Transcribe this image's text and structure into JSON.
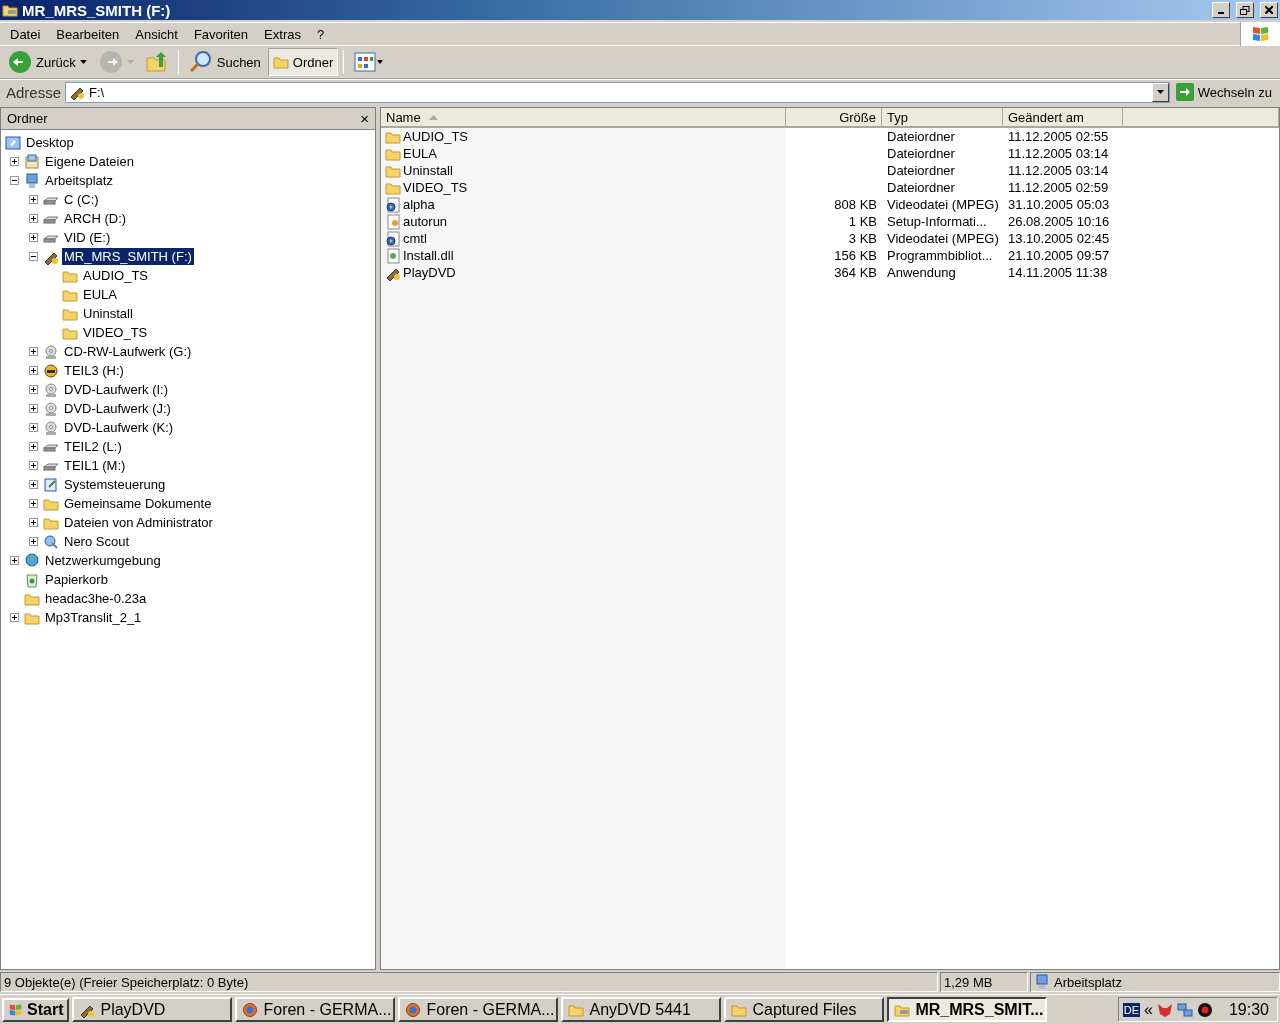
{
  "window": {
    "title": "MR_MRS_SMITH (F:)"
  },
  "menu": [
    "Datei",
    "Bearbeiten",
    "Ansicht",
    "Favoriten",
    "Extras",
    "?"
  ],
  "toolbar": [
    {
      "kind": "back",
      "label": "Zurück",
      "pressed": false,
      "disabled": false
    },
    {
      "kind": "forward",
      "pressed": false,
      "disabled": true
    },
    {
      "kind": "up",
      "pressed": false,
      "disabled": false
    },
    {
      "kind": "search",
      "label": "Suchen",
      "pressed": false,
      "disabled": false
    },
    {
      "kind": "folders",
      "label": "Ordner",
      "pressed": true,
      "disabled": false
    },
    {
      "kind": "views",
      "pressed": false,
      "disabled": false
    }
  ],
  "address": {
    "label": "Adresse",
    "value": "F:\\",
    "go_button": "Wechseln zu"
  },
  "folder_pane": {
    "title": "Ordner",
    "close": "×",
    "tree": [
      {
        "label": "Desktop",
        "kind": "desktop",
        "selected": false,
        "children": [
          {
            "label": "Eigene Dateien",
            "kind": "docs",
            "expanded": false,
            "selected": false
          },
          {
            "label": "Arbeitsplatz",
            "kind": "computer",
            "expanded": true,
            "selected": false,
            "children": [
              {
                "label": "C (C:)",
                "kind": "drive",
                "expanded": false,
                "selected": false
              },
              {
                "label": "ARCH (D:)",
                "kind": "drive",
                "expanded": false,
                "selected": false
              },
              {
                "label": "VID (E:)",
                "kind": "drive",
                "expanded": false,
                "selected": false
              },
              {
                "label": "MR_MRS_SMITH (F:)",
                "kind": "film",
                "expanded": true,
                "selected": true,
                "children": [
                  {
                    "label": "AUDIO_TS",
                    "kind": "folder",
                    "selected": false
                  },
                  {
                    "label": "EULA",
                    "kind": "folder",
                    "selected": false
                  },
                  {
                    "label": "Uninstall",
                    "kind": "folder",
                    "selected": false
                  },
                  {
                    "label": "VIDEO_TS",
                    "kind": "folder",
                    "selected": false
                  }
                ]
              },
              {
                "label": "CD-RW-Laufwerk (G:)",
                "kind": "cd",
                "expanded": false,
                "selected": false
              },
              {
                "label": "TEIL3 (H:)",
                "kind": "mascot",
                "expanded": false,
                "selected": false
              },
              {
                "label": "DVD-Laufwerk (I:)",
                "kind": "cd",
                "expanded": false,
                "selected": false
              },
              {
                "label": "DVD-Laufwerk (J:)",
                "kind": "cd",
                "expanded": false,
                "selected": false
              },
              {
                "label": "DVD-Laufwerk (K:)",
                "kind": "cd",
                "expanded": false,
                "selected": false
              },
              {
                "label": "TEIL2 (L:)",
                "kind": "drive",
                "expanded": false,
                "selected": false
              },
              {
                "label": "TEIL1 (M:)",
                "kind": "drive",
                "expanded": false,
                "selected": false
              },
              {
                "label": "Systemsteuerung",
                "kind": "control",
                "expanded": false,
                "selected": false
              },
              {
                "label": "Gemeinsame Dokumente",
                "kind": "folder",
                "expanded": false,
                "selected": false
              },
              {
                "label": "Dateien von Administrator",
                "kind": "folder",
                "expanded": false,
                "selected": false
              },
              {
                "label": "Nero Scout",
                "kind": "nero",
                "expanded": false,
                "selected": false
              }
            ]
          },
          {
            "label": "Netzwerkumgebung",
            "kind": "network",
            "expanded": false,
            "selected": false
          },
          {
            "label": "Papierkorb",
            "kind": "recycle",
            "selected": false
          },
          {
            "label": "headac3he-0.23a",
            "kind": "folder",
            "selected": false
          },
          {
            "label": "Mp3Translit_2_1",
            "kind": "folder",
            "expanded": false,
            "selected": false
          }
        ]
      }
    ]
  },
  "file_list": {
    "columns": [
      {
        "label": "Name",
        "sorted": true
      },
      {
        "label": "Größe",
        "sorted": false
      },
      {
        "label": "Typ",
        "sorted": false
      },
      {
        "label": "Geändert am",
        "sorted": false
      }
    ],
    "rows": [
      {
        "kind": "folder",
        "name": "AUDIO_TS",
        "type": "Dateiordner",
        "modified": "11.12.2005 02:55"
      },
      {
        "kind": "folder",
        "name": "EULA",
        "type": "Dateiordner",
        "modified": "11.12.2005 03:14"
      },
      {
        "kind": "folder",
        "name": "Uninstall",
        "type": "Dateiordner",
        "modified": "11.12.2005 03:14"
      },
      {
        "kind": "folder",
        "name": "VIDEO_TS",
        "type": "Dateiordner",
        "modified": "11.12.2005 02:59"
      },
      {
        "kind": "video",
        "name": "alpha",
        "size": "808 KB",
        "type": "Videodatei (MPEG)",
        "modified": "31.10.2005 05:03"
      },
      {
        "kind": "setup",
        "name": "autorun",
        "size": "1 KB",
        "type": "Setup-Informati...",
        "modified": "26.08.2005 10:16"
      },
      {
        "kind": "video",
        "name": "cmtl",
        "size": "3 KB",
        "type": "Videodatei (MPEG)",
        "modified": "13.10.2005 02:45"
      },
      {
        "kind": "dll",
        "name": "Install.dll",
        "size": "156 KB",
        "type": "Programmbibliot...",
        "modified": "21.10.2005 09:57"
      },
      {
        "kind": "film",
        "name": "PlayDVD",
        "size": "364 KB",
        "type": "Anwendung",
        "modified": "14.11.2005 11:38"
      }
    ]
  },
  "status_bar": {
    "objects": "9 Objekte(e) (Freier Speicherplatz: 0 Byte)",
    "size": "1,29 MB",
    "zone": "Arbeitsplatz"
  },
  "taskbar": {
    "start": "Start",
    "tasks": [
      {
        "label": "PlayDVD",
        "kind": "film",
        "selected": false
      },
      {
        "label": "Foren - GERMA...",
        "kind": "browser",
        "selected": false
      },
      {
        "label": "Foren - GERMA...",
        "kind": "browser",
        "selected": false
      },
      {
        "label": "AnyDVD 5441",
        "kind": "folder",
        "selected": false
      },
      {
        "label": "Captured Files",
        "kind": "folder",
        "selected": false
      },
      {
        "label": "MR_MRS_SMIT...",
        "kind": "drive-folder",
        "selected": true
      }
    ],
    "language": "DE",
    "tray_toggle": "«",
    "clock": "19:30"
  }
}
